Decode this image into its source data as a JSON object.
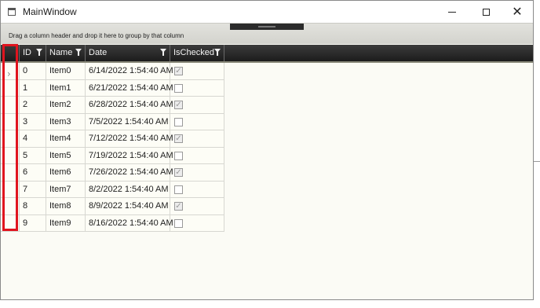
{
  "window": {
    "title": "MainWindow"
  },
  "group_panel": {
    "hint": "Drag a column header and drop it here to group by that column"
  },
  "columns": [
    {
      "label": "ID"
    },
    {
      "label": "Name"
    },
    {
      "label": "Date"
    },
    {
      "label": "IsChecked"
    }
  ],
  "rows": [
    {
      "id": "0",
      "name": "Item0",
      "date": "6/14/2022 1:54:40 AM",
      "checked": true
    },
    {
      "id": "1",
      "name": "Item1",
      "date": "6/21/2022 1:54:40 AM",
      "checked": false
    },
    {
      "id": "2",
      "name": "Item2",
      "date": "6/28/2022 1:54:40 AM",
      "checked": true
    },
    {
      "id": "3",
      "name": "Item3",
      "date": "7/5/2022 1:54:40 AM",
      "checked": false
    },
    {
      "id": "4",
      "name": "Item4",
      "date": "7/12/2022 1:54:40 AM",
      "checked": true
    },
    {
      "id": "5",
      "name": "Item5",
      "date": "7/19/2022 1:54:40 AM",
      "checked": false
    },
    {
      "id": "6",
      "name": "Item6",
      "date": "7/26/2022 1:54:40 AM",
      "checked": true
    },
    {
      "id": "7",
      "name": "Item7",
      "date": "8/2/2022 1:54:40 AM",
      "checked": false
    },
    {
      "id": "8",
      "name": "Item8",
      "date": "8/9/2022 1:54:40 AM",
      "checked": true
    },
    {
      "id": "9",
      "name": "Item9",
      "date": "8/16/2022 1:54:40 AM",
      "checked": false
    }
  ],
  "current_row_indicator": "›",
  "colors": {
    "highlight": "#e0141e",
    "header_bg": "#1c1c1c"
  }
}
